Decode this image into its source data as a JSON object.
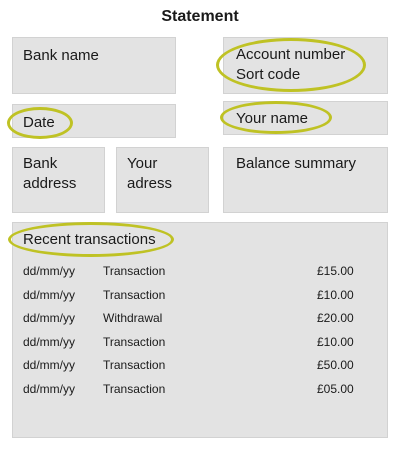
{
  "title": "Statement",
  "sections": {
    "bank_name": "Bank name",
    "account_number": "Account number",
    "sort_code": "Sort code",
    "date": "Date",
    "your_name": "Your name",
    "bank_address_line1": "Bank",
    "bank_address_line2": "address",
    "your_address_line1": "Your",
    "your_address_line2": "adress",
    "balance_summary": "Balance summary",
    "recent_transactions": "Recent transactions"
  },
  "transactions": [
    {
      "date": "dd/mm/yy",
      "description": "Transaction",
      "amount": "£15.00"
    },
    {
      "date": "dd/mm/yy",
      "description": "Transaction",
      "amount": "£10.00"
    },
    {
      "date": "dd/mm/yy",
      "description": "Withdrawal",
      "amount": "£20.00"
    },
    {
      "date": "dd/mm/yy",
      "description": "Transaction",
      "amount": "£10.00"
    },
    {
      "date": "dd/mm/yy",
      "description": "Transaction",
      "amount": "£50.00"
    },
    {
      "date": "dd/mm/yy",
      "description": "Transaction",
      "amount": "£05.00"
    }
  ],
  "colors": {
    "box_fill": "#e3e3e3",
    "highlight_ring": "#bfc224"
  }
}
